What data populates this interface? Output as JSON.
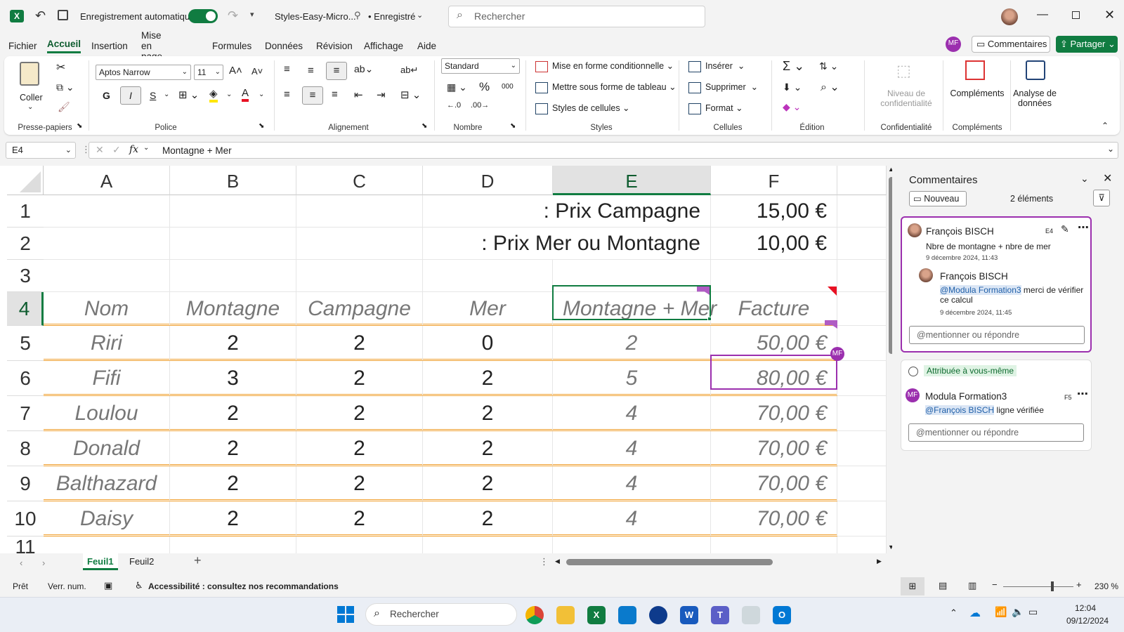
{
  "title": {
    "autosave_label": "Enregistrement automatique",
    "filename": "Styles-Easy-Micro...",
    "saved": "• Enregistré",
    "search_placeholder": "Rechercher"
  },
  "menu": [
    "Fichier",
    "Accueil",
    "Insertion",
    "Mise en page",
    "Formules",
    "Données",
    "Révision",
    "Affichage",
    "Aide"
  ],
  "menu_right": {
    "user_initials": "MF",
    "comments": "Commentaires",
    "share": "Partager"
  },
  "ribbon": {
    "clipboard": {
      "paste": "Coller",
      "label": "Presse-papiers"
    },
    "font": {
      "name": "Aptos Narrow",
      "size": "11",
      "bold": "G",
      "italic": "I",
      "underline": "S",
      "label": "Police"
    },
    "alignment": {
      "label": "Alignement"
    },
    "number": {
      "format": "Standard",
      "label": "Nombre"
    },
    "styles": {
      "cond": "Mise en forme conditionnelle",
      "table": "Mettre sous forme de tableau",
      "cell": "Styles de cellules",
      "label": "Styles"
    },
    "cells": {
      "insert": "Insérer",
      "delete": "Supprimer",
      "format": "Format",
      "label": "Cellules"
    },
    "editing": {
      "label": "Édition"
    },
    "confidentiality": {
      "level": "Niveau de confidentialité",
      "label": "Confidentialité"
    },
    "addins": {
      "label": "Compléments",
      "btn": "Compléments"
    },
    "analysis": {
      "btn": "Analyse de données"
    }
  },
  "formula_bar": {
    "namebox": "E4",
    "fx": "fx",
    "content": "Montagne + Mer"
  },
  "sheet": {
    "columns": [
      "A",
      "B",
      "C",
      "D",
      "E",
      "F"
    ],
    "rows": [
      "1",
      "2",
      "3",
      "4",
      "5",
      "6",
      "7",
      "8",
      "9",
      "10",
      "11"
    ],
    "prix_campagne_label": "Prix Campagne :",
    "prix_campagne": "15,00 €",
    "prix_mer_label": "Prix Mer ou Montagne :",
    "prix_mer": "10,00 €",
    "headers": [
      "Nom",
      "Montagne",
      "Campagne",
      "Mer",
      "Montagne + Mer",
      "Facture"
    ],
    "data": [
      [
        "Riri",
        "2",
        "2",
        "0",
        "2",
        "50,00 €"
      ],
      [
        "Fifi",
        "3",
        "2",
        "2",
        "5",
        "80,00 €"
      ],
      [
        "Loulou",
        "2",
        "2",
        "2",
        "4",
        "70,00 €"
      ],
      [
        "Donald",
        "2",
        "2",
        "2",
        "4",
        "70,00 €"
      ],
      [
        "Balthazard",
        "2",
        "2",
        "2",
        "4",
        "70,00 €"
      ],
      [
        "Daisy",
        "2",
        "2",
        "2",
        "4",
        "70,00 €"
      ]
    ],
    "presence_badge": "MF"
  },
  "comments_panel": {
    "title": "Commentaires",
    "new": "Nouveau",
    "count": "2 éléments",
    "thread1": {
      "author": "François BISCH",
      "cell": "E4",
      "text": "Nbre de montagne + nbre de mer",
      "date": "9 décembre 2024, 11:43",
      "reply_author": "François BISCH",
      "reply_mention": "@Modula Formation3",
      "reply_text": " merci de vérifier ce calcul",
      "reply_date": "9 décembre 2024, 11:45",
      "reply_placeholder": "@mentionner ou répondre"
    },
    "thread2": {
      "assigned": "Attribuée à vous-même",
      "author": "Modula Formation3",
      "cell": "F5",
      "mention": "@François BISCH",
      "text": " ligne vérifiée",
      "reply_placeholder": "@mentionner ou répondre"
    }
  },
  "tabs": [
    "Feuil1",
    "Feuil2"
  ],
  "status": {
    "ready": "Prêt",
    "numlock": "Verr. num.",
    "accessibility": "Accessibilité : consultez nos recommandations",
    "zoom": "230 %"
  },
  "taskbar": {
    "search": "Rechercher",
    "time": "12:04",
    "date": "09/12/2024"
  },
  "colors": {
    "excel_green": "#107c41",
    "accent_purple": "#9b2fae",
    "orange_border": "#f0a030",
    "comment_red": "#e81123"
  }
}
